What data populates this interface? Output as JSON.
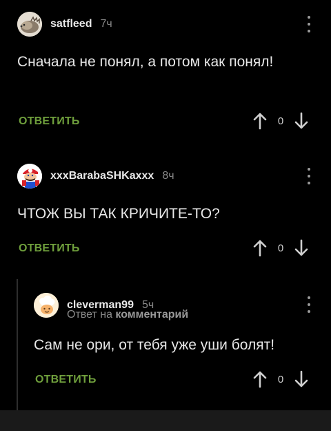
{
  "comments": [
    {
      "user": "satfleed",
      "time": "7ч",
      "text": "Сначала не понял, а потом как понял!",
      "reply_label": "ОТВЕТИТЬ",
      "score": "0",
      "avatar_icon": "hedgehog-avatar"
    },
    {
      "user": "xxxBarabaSHKaxxx",
      "time": "8ч",
      "text": "ЧТОЖ ВЫ ТАК КРИЧИТЕ-ТО?",
      "reply_label": "ОТВЕТИТЬ",
      "score": "0",
      "avatar_icon": "mario-avatar"
    },
    {
      "user": "cleverman99",
      "time": "5ч",
      "reply_to_prefix": "Ответ на",
      "reply_to_target": "комментарий",
      "text": "Сам не ори, от тебя уже уши болят!",
      "reply_label": "ОТВЕТИТЬ",
      "score": "0",
      "avatar_icon": "chef-avatar"
    }
  ],
  "colors": {
    "background": "#000000",
    "accent_green": "#6f9f3c",
    "muted": "#8a8a8a"
  }
}
